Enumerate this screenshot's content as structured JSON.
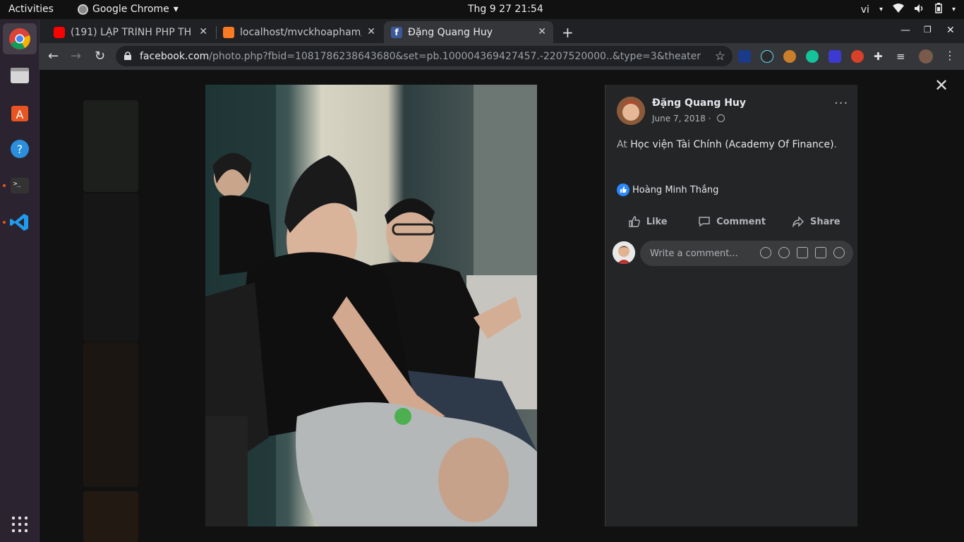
{
  "system": {
    "activities": "Activities",
    "app_name": "Google Chrome",
    "clock": "Thg 9 27  21:54",
    "lang": "vi"
  },
  "tabs": [
    {
      "title": "(191) LẬP TRÌNH PHP THE",
      "favicon": "youtube-icon"
    },
    {
      "title": "localhost/mvckhoapham/",
      "favicon": "xampp-icon"
    },
    {
      "title": "Đặng Quang Huy",
      "favicon": "facebook-icon"
    }
  ],
  "url": {
    "host": "facebook.com",
    "path": "/photo.php?fbid=1081786238643680&set=pb.100004369427457.-2207520000..&type=3&theater"
  },
  "post": {
    "author": "Đặng Quang Huy",
    "date": "June 7, 2018 · ",
    "location_prefix": "At ",
    "location_place": "Học viện Tài Chính (Academy Of Finance)",
    "location_suffix": ".",
    "reactor": "Hoàng Minh Thắng",
    "more": "···"
  },
  "actions": {
    "like": "Like",
    "comment": "Comment",
    "share": "Share"
  },
  "comment": {
    "placeholder": "Write a comment..."
  },
  "colors": {
    "chrome_bg": "#202124",
    "panel_bg": "#242526",
    "like_blue": "#2d88ff"
  }
}
